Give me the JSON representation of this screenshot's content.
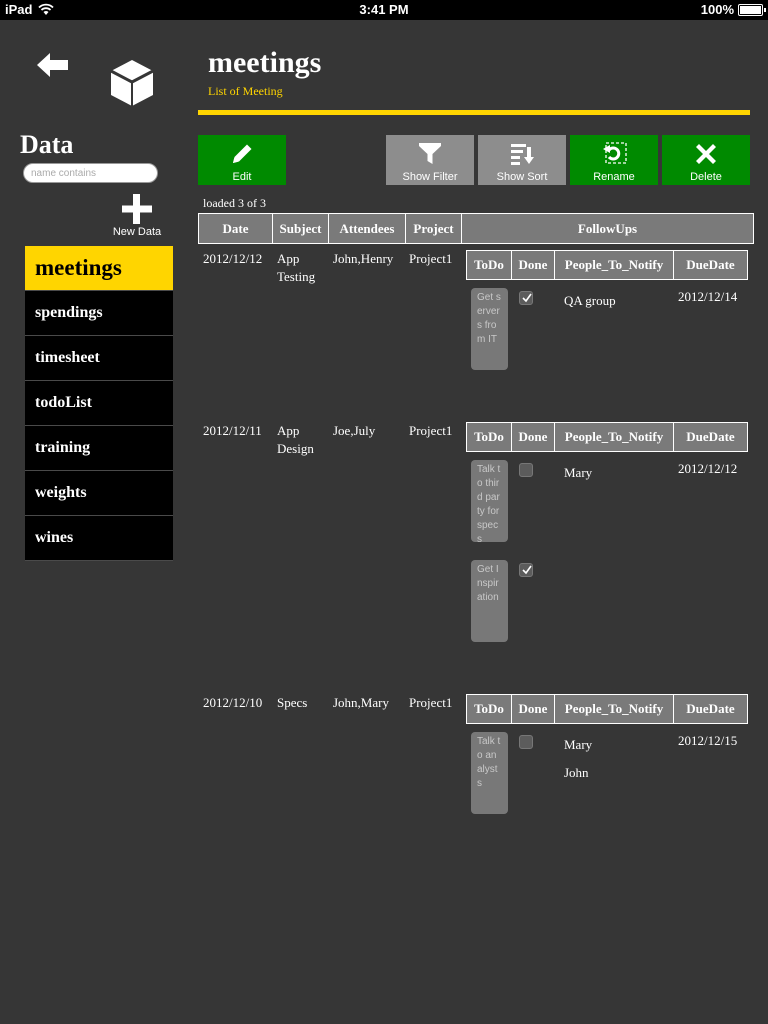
{
  "status": {
    "carrier": "iPad",
    "time": "3:41 PM",
    "battery": "100%"
  },
  "sidebar": {
    "title": "Data",
    "search_placeholder": "name contains",
    "new_label": "New Data",
    "items": [
      "meetings",
      "spendings",
      "timesheet",
      "todoList",
      "training",
      "weights",
      "wines"
    ],
    "active_index": 0
  },
  "header": {
    "title": "meetings",
    "subtitle": "List of Meeting"
  },
  "toolbar": {
    "edit": "Edit",
    "show_filter": "Show Filter",
    "show_sort": "Show Sort",
    "rename": "Rename",
    "delete": "Delete"
  },
  "loaded_text": "loaded 3 of 3",
  "table": {
    "columns": [
      "Date",
      "Subject",
      "Attendees",
      "Project",
      "FollowUps"
    ],
    "followup_columns": [
      "ToDo",
      "Done",
      "People_To_Notify",
      "DueDate"
    ],
    "rows": [
      {
        "date": "2012/12/12",
        "subject_lines": [
          "App",
          "Testing"
        ],
        "attendees": "John,Henry",
        "project": "Project1",
        "followups": [
          {
            "todo": "Get servers from IT",
            "done": true,
            "people": [
              "QA group"
            ],
            "due": "2012/12/14"
          }
        ]
      },
      {
        "date": "2012/12/11",
        "subject_lines": [
          "App",
          "Design"
        ],
        "attendees": "Joe,July",
        "project": "Project1",
        "followups": [
          {
            "todo": "Talk to third party for specs",
            "done": false,
            "people": [
              "Mary"
            ],
            "due": "2012/12/12"
          },
          {
            "todo": "Get Inspiration",
            "done": true,
            "people": [],
            "due": ""
          }
        ]
      },
      {
        "date": "2012/12/10",
        "subject_lines": [
          "Specs"
        ],
        "attendees": "John,Mary",
        "project": "Project1",
        "followups": [
          {
            "todo": "Talk to analysts",
            "done": false,
            "people": [
              "Mary",
              "John"
            ],
            "due": "2012/12/15"
          }
        ]
      }
    ]
  },
  "colors": {
    "accent": "#ffd500",
    "green": "#008a00",
    "grey_button": "#8d8d8d",
    "background": "#363636"
  }
}
